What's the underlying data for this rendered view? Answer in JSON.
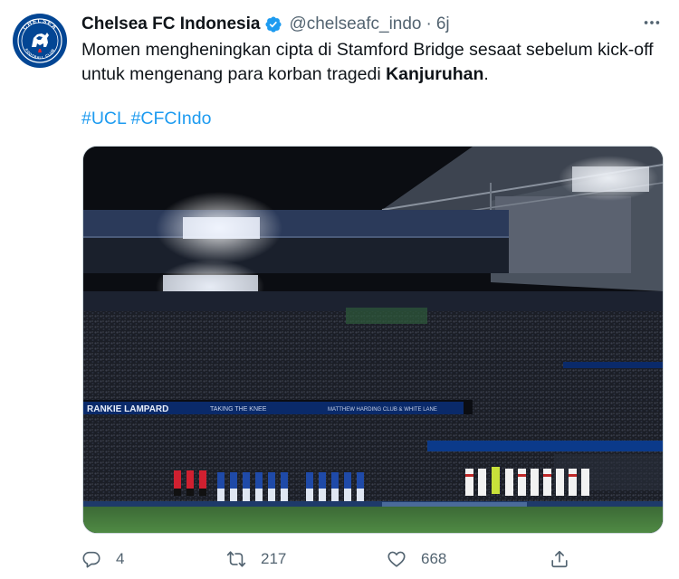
{
  "account": {
    "display_name": "Chelsea FC Indonesia",
    "handle": "@chelseafc_indo",
    "separator": "·",
    "time": "6j",
    "avatar_text_top": "CHELSEA",
    "avatar_text_bottom": "FOOTBALL CLUB"
  },
  "tweet": {
    "text_before": "Momen mengheningkan cipta di Stamford Bridge sesaat sebelum kick-off untuk mengenang para korban tragedi ",
    "text_bold": "Kanjuruhan",
    "text_after": ".",
    "hashtags": [
      "#UCL",
      "#CFCIndo"
    ]
  },
  "media": {
    "banner_text_1": "RANKIE LAMPARD",
    "banner_text_2": "TAKING THE KNEE",
    "banner_text_3": "MATTHEW HARDING CLUB & WHITE LANE"
  },
  "actions": {
    "replies": "4",
    "retweets": "217",
    "likes": "668"
  },
  "colors": {
    "accent": "#1d9bf0",
    "muted": "#536471",
    "chelsea_blue": "#034694"
  },
  "icons": [
    "verified-badge-icon",
    "more-icon",
    "reply-icon",
    "retweet-icon",
    "like-icon",
    "share-icon"
  ]
}
